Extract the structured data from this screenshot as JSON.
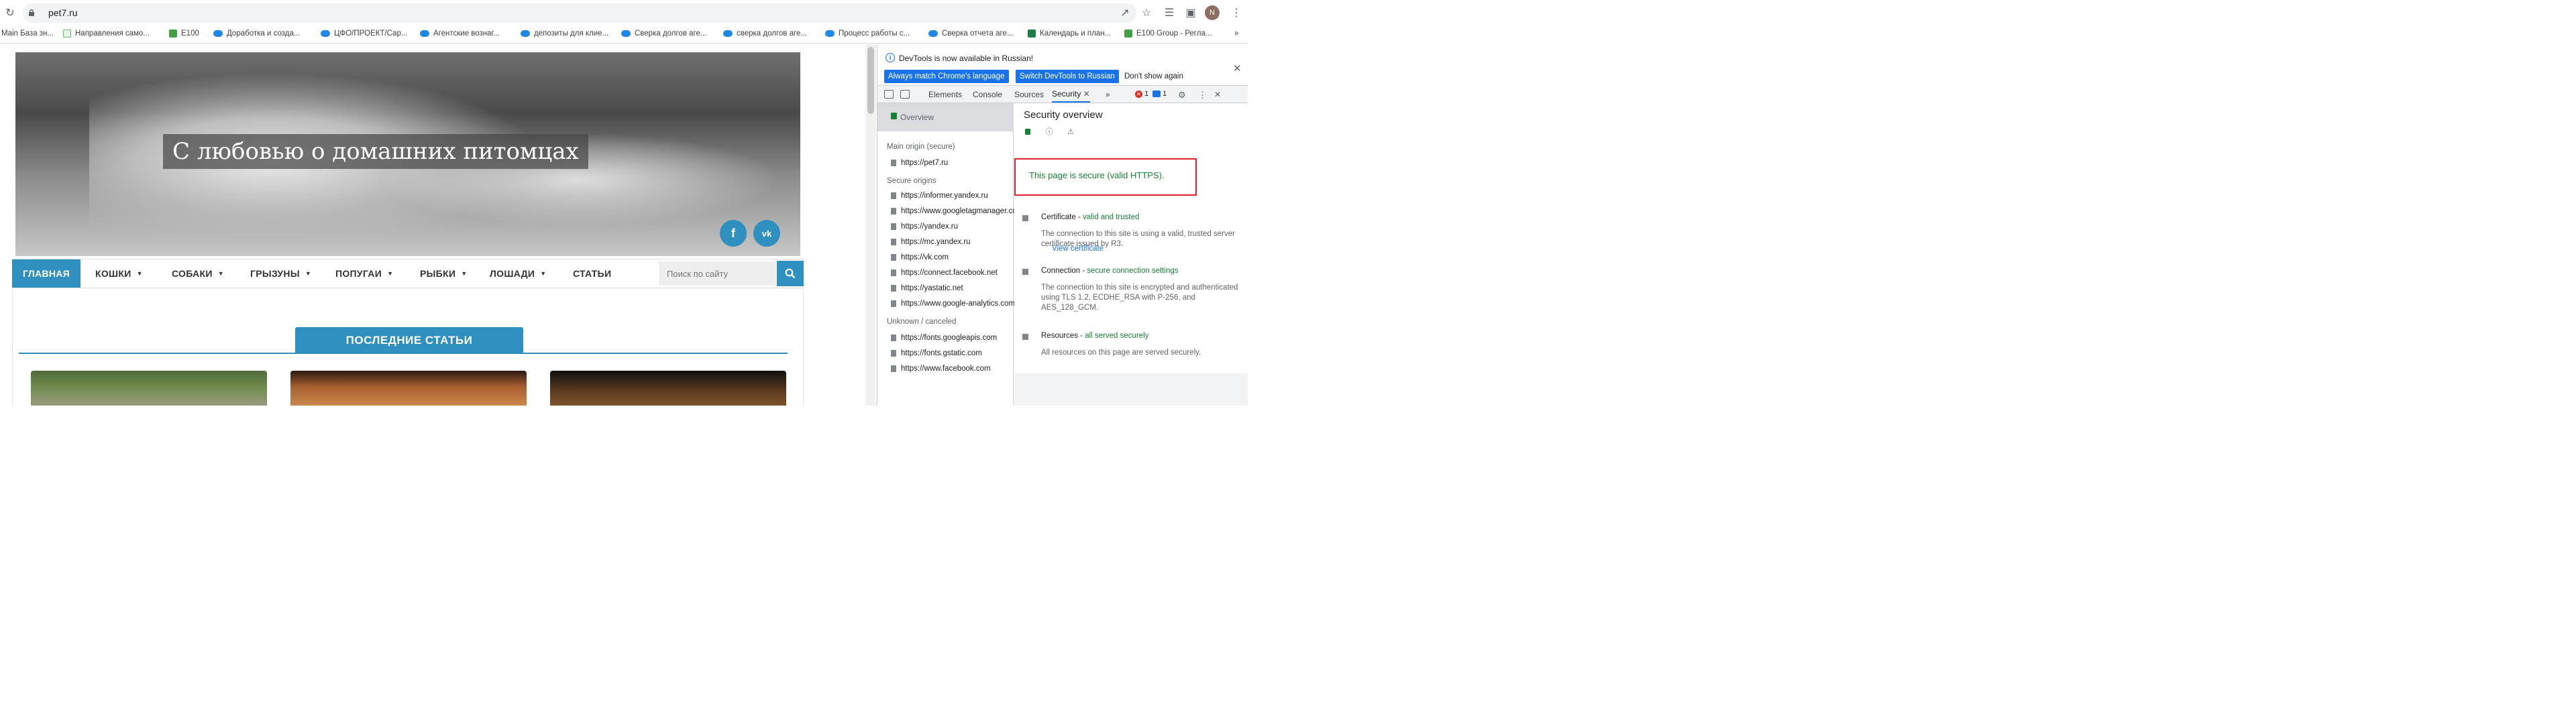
{
  "browser": {
    "url": "pet7.ru",
    "avatar_letter": "N",
    "bookmarks": [
      "Main База зн...",
      "Направления само...",
      "Е100",
      "Доработка и созда...",
      "ЦФО/ПРОЕКТ/Сар...",
      "Агентские вознаг...",
      "депозиты для клие...",
      "Сверка долгов аге...",
      "сверка долгов аге...",
      "Процесс работы с...",
      "Сверка отчета аге...",
      "Календарь и план...",
      "Е100 Group - Регла..."
    ],
    "bookmarks_more": "»"
  },
  "site": {
    "hero_title": "С любовью о домашних питомцах",
    "social": {
      "facebook": "f",
      "vk": "vk"
    },
    "nav": [
      "ГЛАВНАЯ",
      "КОШКИ",
      "СОБАКИ",
      "ГРЫЗУНЫ",
      "ПОПУГАИ",
      "РЫБКИ",
      "ЛОШАДИ",
      "СТАТЬИ"
    ],
    "search_placeholder": "Поиск по сайту",
    "section_title": "ПОСЛЕДНИЕ СТАТЬИ"
  },
  "devtools": {
    "info_text": "DevTools is now available in Russian!",
    "btn_match": "Always match Chrome's language",
    "btn_switch": "Switch DevTools to Russian",
    "btn_dismiss": "Don't show again",
    "tabs": [
      "Elements",
      "Console",
      "Sources",
      "Security"
    ],
    "more_tabs": "»",
    "errors": "1",
    "messages": "1",
    "sidebar": {
      "overview": "Overview",
      "main_origin_head": "Main origin (secure)",
      "main_origin": "https://pet7.ru",
      "secure_head": "Secure origins",
      "secure": [
        "https://informer.yandex.ru",
        "https://www.googletagmanager.com",
        "https://yandex.ru",
        "https://mc.yandex.ru",
        "https://vk.com",
        "https://connect.facebook.net",
        "https://yastatic.net",
        "https://www.google-analytics.com"
      ],
      "unknown_head": "Unknown / canceled",
      "unknown": [
        "https://fonts.googleapis.com",
        "https://fonts.gstatic.com",
        "https://www.facebook.com"
      ]
    },
    "main": {
      "title": "Security overview",
      "summary": "This page is secure (valid HTTPS).",
      "cert_head": "Certificate - ",
      "cert_status": "valid and trusted",
      "cert_text": "The connection to this site is using a valid, trusted server certificate issued by R3.",
      "view_cert": "View certificate",
      "conn_head": "Connection - ",
      "conn_status": "secure connection settings",
      "conn_text": "The connection to this site is encrypted and authenticated using TLS 1.2, ECDHE_RSA with P-256, and AES_128_GCM.",
      "res_head": "Resources - ",
      "res_status": "all served securely",
      "res_text": "All resources on this page are served securely."
    }
  },
  "colors": {
    "site_accent": "#2f8fbf",
    "secure_green": "#188038",
    "highlight_red": "#e0212c",
    "devtools_blue": "#1a73e8"
  }
}
